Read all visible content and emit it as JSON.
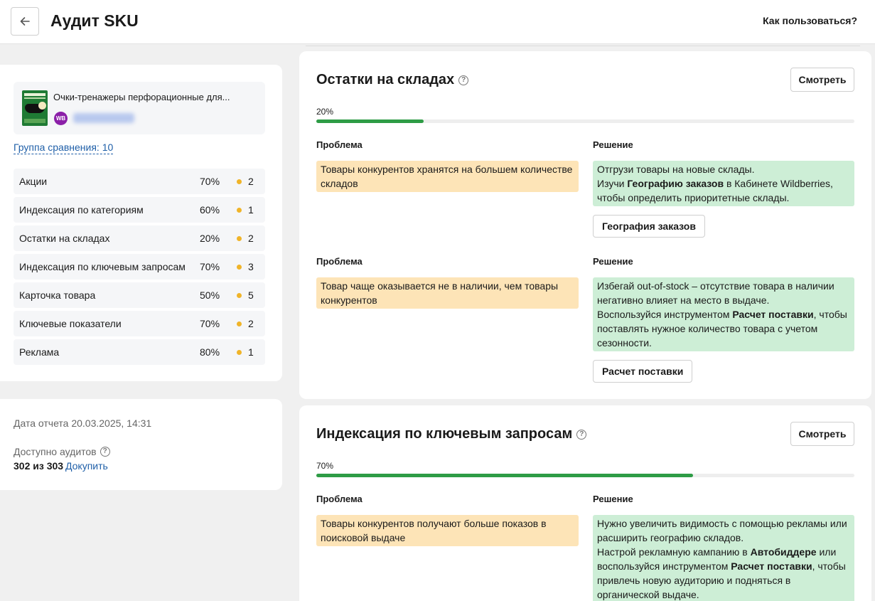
{
  "header": {
    "title": "Аудит SKU",
    "help_link": "Как пользоваться?"
  },
  "product": {
    "name": "Очки-тренажеры перфорационные для...",
    "marketplace_badge": "WB"
  },
  "compare_group": "Группа сравнения: 10",
  "metrics": [
    {
      "label": "Акции",
      "percent": "70%",
      "count": "2"
    },
    {
      "label": "Индексация по категориям",
      "percent": "60%",
      "count": "1"
    },
    {
      "label": "Остатки на складах",
      "percent": "20%",
      "count": "2"
    },
    {
      "label": "Индексация по ключевым запросам",
      "percent": "70%",
      "count": "3"
    },
    {
      "label": "Карточка товара",
      "percent": "50%",
      "count": "5"
    },
    {
      "label": "Ключевые показатели",
      "percent": "70%",
      "count": "2"
    },
    {
      "label": "Реклама",
      "percent": "80%",
      "count": "1"
    }
  ],
  "info": {
    "report_date": "Дата отчета 20.03.2025, 14:31",
    "audits_label": "Доступно аудитов",
    "audits_value": "302 из 303",
    "buy_link": "Докупить"
  },
  "sections": [
    {
      "title": "Остатки на складах",
      "view_button": "Смотреть",
      "percent_label": "20%",
      "progress": 0.2,
      "items": [
        {
          "problem_head": "Проблема",
          "solution_head": "Решение",
          "problem": "Товары конкурентов хранятся на большем количестве складов",
          "solution": [
            {
              "t": "Отгрузи товары на новые склады."
            },
            {
              "br": true
            },
            {
              "t": "Изучи "
            },
            {
              "b": "Географию заказов"
            },
            {
              "t": " в Кабинете Wildberries, чтобы определить приоритетные склады."
            }
          ],
          "action": "География заказов"
        },
        {
          "problem_head": "Проблема",
          "solution_head": "Решение",
          "problem": "Товар чаще оказывается не в наличии, чем товары конкурентов",
          "solution": [
            {
              "t": "Избегай out-of-stock – отсутствие товара в наличии негативно влияет на место в выдаче."
            },
            {
              "br": true
            },
            {
              "t": "Воспользуйся инструментом "
            },
            {
              "b": "Расчет поставки"
            },
            {
              "t": ", чтобы поставлять нужное количество товара с учетом сезонности."
            }
          ],
          "action": "Расчет поставки"
        }
      ]
    },
    {
      "title": "Индексация по ключевым запросам",
      "view_button": "Смотреть",
      "percent_label": "70%",
      "progress": 0.7,
      "items": [
        {
          "problem_head": "Проблема",
          "solution_head": "Решение",
          "problem": "Товары конкурентов получают больше показов в поисковой выдаче",
          "solution": [
            {
              "t": "Нужно увеличить видимость с помощью рекламы или расширить географию складов."
            },
            {
              "br": true
            },
            {
              "t": "Настрой рекламную кампанию в "
            },
            {
              "b": "Автобиддере"
            },
            {
              "t": " или воспользуйся инструментом "
            },
            {
              "b": "Расчет поставки"
            },
            {
              "t": ", чтобы привлечь новую аудиторию и подняться в органической выдаче."
            }
          ]
        }
      ]
    }
  ]
}
